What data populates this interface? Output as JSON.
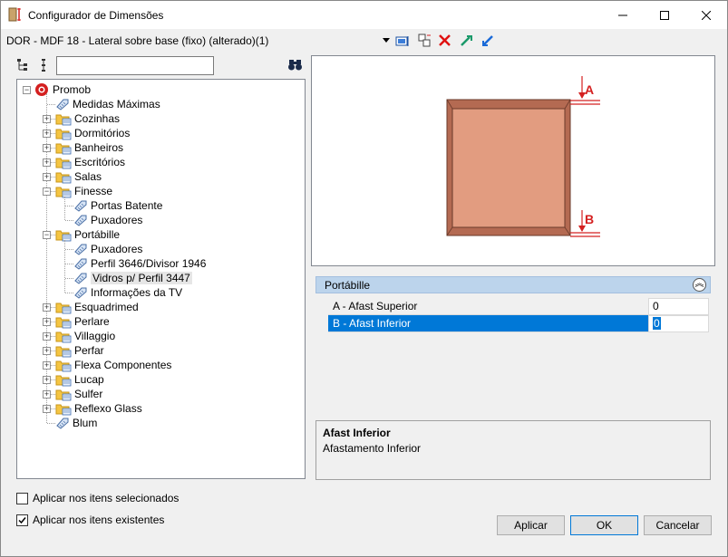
{
  "window": {
    "title": "Configurador de Dimensões"
  },
  "toolbar": {
    "item_name": "DOR - MDF 18 - Lateral sobre base (fixo) (alterado)(1)"
  },
  "search": {
    "value": "",
    "placeholder": ""
  },
  "tree": {
    "root": "Promob",
    "items": [
      {
        "label": "Medidas Máximas",
        "level": 1,
        "type": "tag"
      },
      {
        "label": "Cozinhas",
        "level": 1,
        "type": "folder",
        "expander": "+"
      },
      {
        "label": "Dormitórios",
        "level": 1,
        "type": "folder",
        "expander": "+"
      },
      {
        "label": "Banheiros",
        "level": 1,
        "type": "folder",
        "expander": "+"
      },
      {
        "label": "Escritórios",
        "level": 1,
        "type": "folder",
        "expander": "+"
      },
      {
        "label": "Salas",
        "level": 1,
        "type": "folder",
        "expander": "+"
      },
      {
        "label": "Finesse",
        "level": 1,
        "type": "folder",
        "expander": "−"
      },
      {
        "label": "Portas Batente",
        "level": 2,
        "type": "tag"
      },
      {
        "label": "Puxadores",
        "level": 2,
        "type": "tag"
      },
      {
        "label": "Portábille",
        "level": 1,
        "type": "folder",
        "expander": "−"
      },
      {
        "label": "Puxadores",
        "level": 2,
        "type": "tag"
      },
      {
        "label": "Perfil 3646/Divisor 1946",
        "level": 2,
        "type": "tag"
      },
      {
        "label": "Vidros p/ Perfil 3447",
        "level": 2,
        "type": "tag",
        "selected": true
      },
      {
        "label": "Informações da TV",
        "level": 2,
        "type": "tag"
      },
      {
        "label": "Esquadrimed",
        "level": 1,
        "type": "folder",
        "expander": "+"
      },
      {
        "label": "Perlare",
        "level": 1,
        "type": "folder",
        "expander": "+"
      },
      {
        "label": "Villaggio",
        "level": 1,
        "type": "folder",
        "expander": "+"
      },
      {
        "label": "Perfar",
        "level": 1,
        "type": "folder",
        "expander": "+"
      },
      {
        "label": "Flexa Componentes",
        "level": 1,
        "type": "folder",
        "expander": "+"
      },
      {
        "label": "Lucap",
        "level": 1,
        "type": "folder",
        "expander": "+"
      },
      {
        "label": "Sulfer",
        "level": 1,
        "type": "folder",
        "expander": "+"
      },
      {
        "label": "Reflexo Glass",
        "level": 1,
        "type": "folder",
        "expander": "+"
      },
      {
        "label": "Blum",
        "level": 1,
        "type": "tag"
      }
    ]
  },
  "preview": {
    "label_a": "A",
    "label_b": "B",
    "panel_color": "#e29c80",
    "frame_color": "#b46a52",
    "marker_color": "#d42020"
  },
  "properties": {
    "group": "Portábille",
    "rows": [
      {
        "label": "A -  Afast Superior",
        "value": "0"
      },
      {
        "label": "B -  Afast Inferior",
        "value": "0",
        "selected": true
      }
    ]
  },
  "description": {
    "title": "Afast Inferior",
    "text": "Afastamento Inferior"
  },
  "options": {
    "apply_selected": {
      "label": "Aplicar nos itens selecionados",
      "checked": false
    },
    "apply_existing": {
      "label": "Aplicar nos itens existentes",
      "checked": true
    }
  },
  "buttons": {
    "apply": "Aplicar",
    "ok": "OK",
    "cancel": "Cancelar"
  },
  "icons": {
    "minimize": "minimize-icon",
    "maximize": "maximize-icon",
    "close": "close-icon"
  }
}
